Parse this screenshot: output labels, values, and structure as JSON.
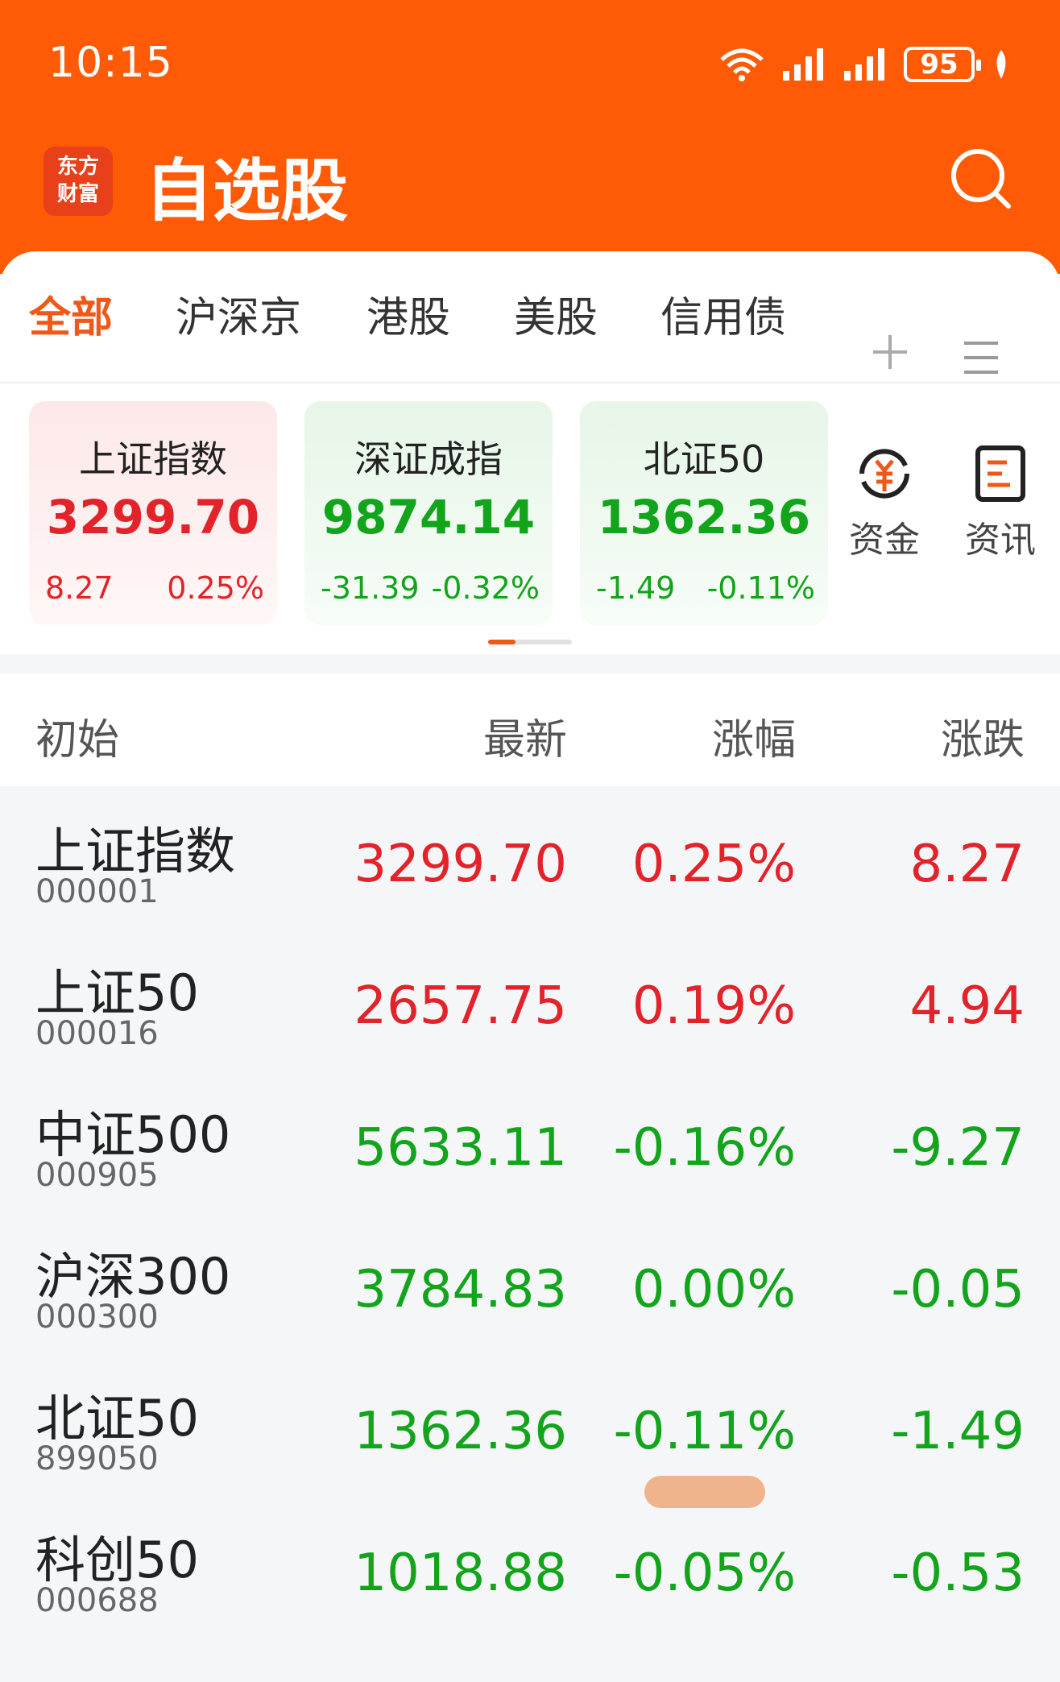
{
  "status_bar": {
    "time": "10:15",
    "battery": "95"
  },
  "header": {
    "logo_line1": "东方",
    "logo_line2": "财富",
    "title": "自选股"
  },
  "tabs": [
    {
      "label": "全部",
      "active": true
    },
    {
      "label": "沪深京",
      "active": false
    },
    {
      "label": "港股",
      "active": false
    },
    {
      "label": "美股",
      "active": false
    },
    {
      "label": "信用债",
      "active": false
    }
  ],
  "index_cards": [
    {
      "name": "上证指数",
      "value": "3299.70",
      "change": "8.27",
      "pct": "0.25%",
      "trend": "up"
    },
    {
      "name": "深证成指",
      "value": "9874.14",
      "change": "-31.39",
      "pct": "-0.32%",
      "trend": "down"
    },
    {
      "name": "北证50",
      "value": "1362.36",
      "change": "-1.49",
      "pct": "-0.11%",
      "trend": "down"
    }
  ],
  "quick_links": [
    {
      "label": "资金",
      "icon": "yuan-flow-icon"
    },
    {
      "label": "资讯",
      "icon": "news-icon"
    }
  ],
  "list_header": {
    "name": "初始",
    "latest": "最新",
    "pct": "涨幅",
    "change": "涨跌"
  },
  "rows": [
    {
      "name": "上证指数",
      "code": "000001",
      "latest": "3299.70",
      "pct": "0.25%",
      "change": "8.27",
      "trend": "up"
    },
    {
      "name": "上证50",
      "code": "000016",
      "latest": "2657.75",
      "pct": "0.19%",
      "change": "4.94",
      "trend": "up"
    },
    {
      "name": "中证500",
      "code": "000905",
      "latest": "5633.11",
      "pct": "-0.16%",
      "change": "-9.27",
      "trend": "down"
    },
    {
      "name": "沪深300",
      "code": "000300",
      "latest": "3784.83",
      "pct": "0.00%",
      "change": "-0.05",
      "trend": "down"
    },
    {
      "name": "北证50",
      "code": "899050",
      "latest": "1362.36",
      "pct": "-0.11%",
      "change": "-1.49",
      "trend": "down"
    },
    {
      "name": "科创50",
      "code": "000688",
      "latest": "1018.88",
      "pct": "-0.05%",
      "change": "-0.53",
      "trend": "down"
    }
  ],
  "colors": {
    "brand": "#ff5a05",
    "up": "#e2232a",
    "down": "#12a41b"
  }
}
